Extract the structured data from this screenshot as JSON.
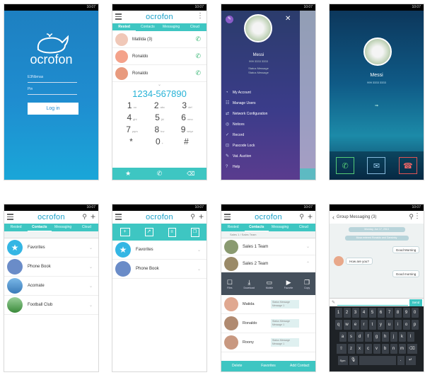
{
  "status_time": "10:07",
  "login": {
    "brand": "ocrofon",
    "username_label": "E3Nbrnas",
    "password_label": "Pin",
    "login_button": "Log in"
  },
  "dialer": {
    "brand": "ocrofon",
    "tabs": [
      "Rested",
      "Contacts",
      "Messaging",
      "Cloud"
    ],
    "contacts": [
      {
        "name": "Matilda (3)"
      },
      {
        "name": "Ronaldo"
      },
      {
        "name": "Ronaldo"
      }
    ],
    "number": "1234-567890",
    "keys": [
      {
        "d": "1",
        "l": "oo"
      },
      {
        "d": "2",
        "l": "abc"
      },
      {
        "d": "3",
        "l": "def"
      },
      {
        "d": "4",
        "l": "ghi"
      },
      {
        "d": "5",
        "l": "jkl"
      },
      {
        "d": "6",
        "l": "mno"
      },
      {
        "d": "7",
        "l": "pqrs"
      },
      {
        "d": "8",
        "l": "tuv"
      },
      {
        "d": "9",
        "l": "wxyz"
      },
      {
        "d": "*",
        "l": ""
      },
      {
        "d": "0",
        "l": "+"
      },
      {
        "d": "#",
        "l": ""
      }
    ]
  },
  "menu": {
    "name": "Messi",
    "number": "999 3333 3333",
    "status1": "Status Message",
    "status2": "Status Message",
    "items": [
      "My Account",
      "Manage Users",
      "Network Configuration",
      "Notices",
      "Record",
      "Pascode Lock",
      "Vat. Auction",
      "Help"
    ]
  },
  "call": {
    "name": "Messi",
    "number": "999 3333 3333"
  },
  "contacts_a": {
    "brand": "ocrofon",
    "tabs": [
      "Rested",
      "Contacts",
      "Messaging",
      "Cloud"
    ],
    "groups": [
      {
        "name": "Favorites",
        "color": "#34b6e4"
      },
      {
        "name": "Phone Book",
        "color": "#6a8cc8"
      },
      {
        "name": "Acomate",
        "color": "#5aa2d8"
      },
      {
        "name": "Football Club",
        "color": "#4a9a48"
      }
    ]
  },
  "contacts_b": {
    "brand": "ocrofon",
    "groups": [
      {
        "name": "Favorites"
      },
      {
        "name": "Phone Book"
      }
    ]
  },
  "groups_panel": {
    "brand": "ocrofon",
    "tabs": [
      "Rested",
      "Contacts",
      "Messaging",
      "Cloud"
    ],
    "breadcrumb": "Sales 1 / Sales Team",
    "groups": [
      "Sales 1 Team",
      "Sales 2 Team"
    ],
    "actions": [
      "Files",
      "Download",
      "Mobile",
      "Favorite",
      "Copy"
    ],
    "members": [
      {
        "name": "Matida",
        "status": "Status Message Message 1"
      },
      {
        "name": "Ronaldo",
        "status": "Status Message Message 1"
      },
      {
        "name": "Roony",
        "status": "Status Message Message 1"
      }
    ],
    "footer": [
      "Delete",
      "Favorites",
      "Add Contact"
    ]
  },
  "chat": {
    "title": "Group Messaging (3)",
    "date": "Monday, Jun 17, 2013",
    "system": "Musa entered Ronaldo and Gansinky",
    "messages": [
      {
        "text": "Good Morning",
        "side": "right"
      },
      {
        "text": "How are you?",
        "side": "left",
        "sender": "Ronaldo"
      },
      {
        "text": "Good morning",
        "side": "right"
      }
    ],
    "send": "Send",
    "keyboard": [
      [
        "1",
        "2",
        "3",
        "4",
        "5",
        "6",
        "7",
        "8",
        "9",
        "0"
      ],
      [
        "q",
        "w",
        "e",
        "r",
        "t",
        "y",
        "u",
        "i",
        "o",
        "p"
      ],
      [
        "a",
        "s",
        "d",
        "f",
        "g",
        "h",
        "j",
        "k",
        "l"
      ],
      [
        "z",
        "x",
        "c",
        "v",
        "b",
        "n",
        "m"
      ]
    ],
    "kbd_sym": "Sym"
  }
}
